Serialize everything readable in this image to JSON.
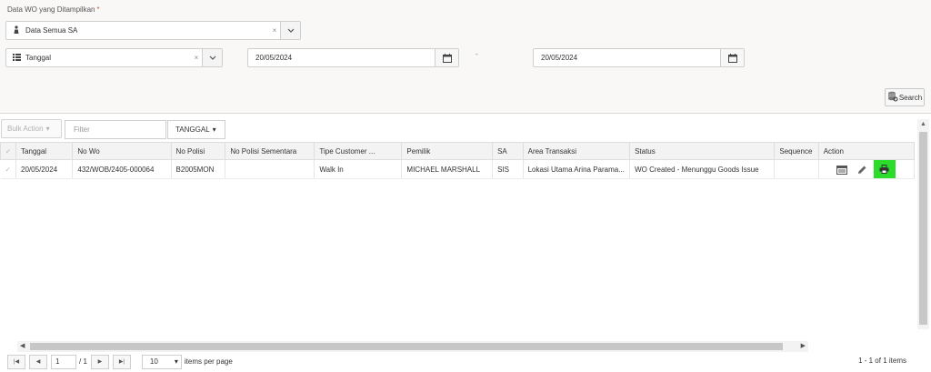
{
  "filters": {
    "label": "Data WO yang Ditampilkan",
    "required_mark": "*",
    "data_select": {
      "value": "Data Semua SA",
      "clear": "×"
    },
    "date_type_select": {
      "value": "Tanggal",
      "clear": "×"
    },
    "date_from": "20/05/2024",
    "date_to": "20/05/2024",
    "range_separator": "-",
    "search_label": "Search"
  },
  "toolbar": {
    "bulk_action": "Bulk Action",
    "filter_placeholder": "Filter",
    "date_dropdown": "TANGGAL"
  },
  "grid": {
    "columns": [
      "Tanggal",
      "No Wo",
      "No Polisi",
      "No Polisi Sementara",
      "Tipe Customer ...",
      "Pemilik",
      "SA",
      "Area Transaksi",
      "Status",
      "Sequence",
      "Action"
    ],
    "rows": [
      {
        "tanggal": "20/05/2024",
        "no_wo": "432/WOB/2405-000064",
        "no_polisi": "B2005MON",
        "no_polisi_sementara": "",
        "tipe_customer": "Walk In",
        "pemilik": "MICHAEL MARSHALL",
        "sa": "SIS",
        "area_transaksi": "Lokasi Utama Arina Parama...",
        "status": "WO Created - Menunggu Goods Issue",
        "sequence": ""
      }
    ]
  },
  "pager": {
    "current_page": "1",
    "total_pages_text": "/ 1",
    "page_size": "10",
    "items_per_page_label": "items per page",
    "info": "1 - 1 of 1 items"
  },
  "colors": {
    "print_button": "#2bdc2b",
    "panel_bg": "#faf8f6"
  }
}
